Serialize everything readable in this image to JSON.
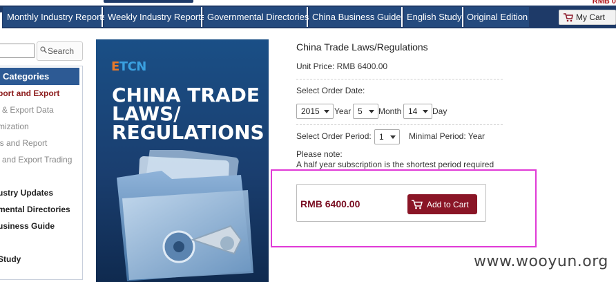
{
  "header": {
    "top_right_text": "RMB 0"
  },
  "nav": {
    "items": [
      {
        "label": "Monthly Industry Reports"
      },
      {
        "label": "Weekly Industry Reports"
      },
      {
        "label": "Governmental Directories"
      },
      {
        "label": "China Business Guide"
      },
      {
        "label": "English Study"
      },
      {
        "label": "Original Edition"
      }
    ],
    "cart_label": "My Cart"
  },
  "search": {
    "placeholder": "",
    "button_label": "Search"
  },
  "sidebar": {
    "header": "Categories",
    "items": [
      {
        "label": "port and Export"
      },
      {
        "label": "& Export Data"
      },
      {
        "label": "mization"
      },
      {
        "label": "is and Report"
      },
      {
        "label": "and Export Trading"
      },
      {
        "label": "ustry Updates"
      },
      {
        "label": "mental Directories"
      },
      {
        "label": "usiness Guide"
      },
      {
        "label": "Study"
      }
    ]
  },
  "product_image": {
    "logo_e": "E",
    "logo_rest": "TCN",
    "title_lines": [
      "CHINA TRADE",
      "LAWS/",
      "REGULATIONS"
    ]
  },
  "product": {
    "title": "China Trade Laws/Regulations",
    "unit_price": "Unit Price: RMB 6400.00",
    "order_date_label": "Select Order Date:",
    "year_value": "2015",
    "year_label": "Year",
    "month_value": "5",
    "month_label": "Month",
    "day_value": "14",
    "day_label": "Day",
    "order_period_label": "Select Order Period:",
    "period_value": "1",
    "minimal_period": "Minimal Period: Year",
    "note_heading": "Please note:",
    "note_text": "A half year subscription is the shortest period required",
    "total_price": "RMB 6400.00",
    "add_to_cart_label": "Add to Cart"
  },
  "watermark": "www.wooyun.org",
  "colors": {
    "nav_bg": "#1e3a68",
    "accent_red": "#8a1526",
    "highlight": "#e03ad6"
  }
}
